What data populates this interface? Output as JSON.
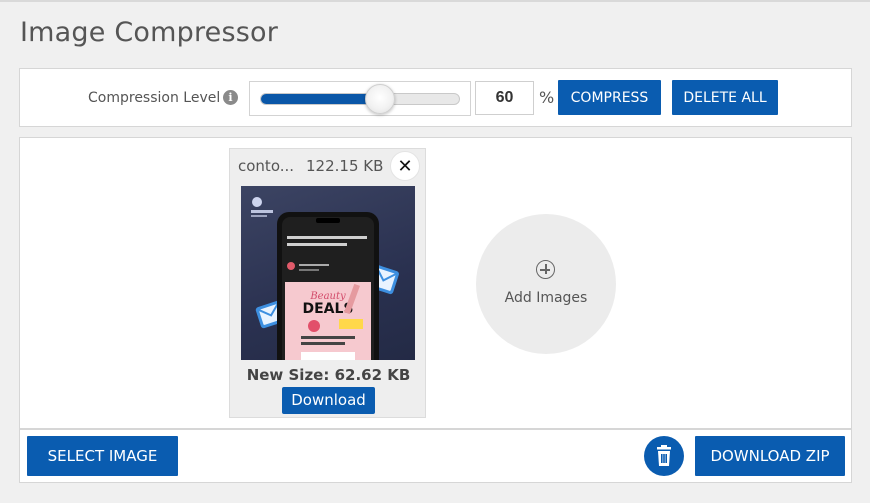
{
  "page": {
    "title": "Image Compressor"
  },
  "settings": {
    "level_label": "Compression Level",
    "info_icon": "info-icon",
    "level_value": "60",
    "level_fraction": 0.6,
    "percent_sign": "%",
    "compress_label": "COMPRESS",
    "delete_all_label": "DELETE ALL"
  },
  "images": [
    {
      "name": "conto...",
      "original_size": "122.15 KB",
      "new_size": "New Size: 62.62 KB",
      "download_label": "Download",
      "close_icon": "close-icon"
    }
  ],
  "add_images": {
    "label": "Add Images",
    "icon": "plus-circle-icon"
  },
  "toolbar": {
    "select_label": "SELECT IMAGE",
    "trash_icon": "trash-icon",
    "zip_label": "DOWNLOAD ZIP"
  },
  "colors": {
    "accent": "#0a5cb0",
    "slider_fill": "#0a57a8",
    "background": "#f0f0f0"
  }
}
